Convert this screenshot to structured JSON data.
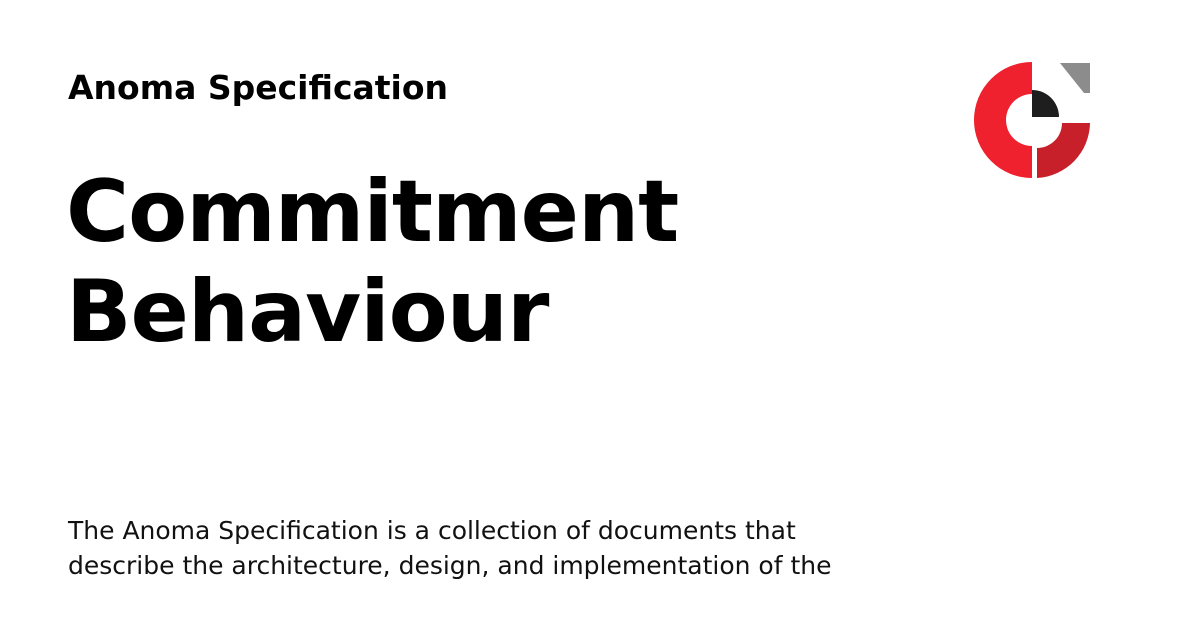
{
  "header": {
    "site_name": "Anoma Specification"
  },
  "title": {
    "line1": "Commitment",
    "line2": "Behaviour"
  },
  "description": {
    "line1": "The Anoma Specification is a collection of documents that",
    "line2": "describe the architecture, design, and implementation of the"
  },
  "logo": {
    "icon": "anoma-logo-icon",
    "colors": {
      "red_left": "#f0212e",
      "red_right": "#c8202b",
      "dark_quarter": "#1e1e1e",
      "gray_corner": "#8c8c8c"
    }
  }
}
